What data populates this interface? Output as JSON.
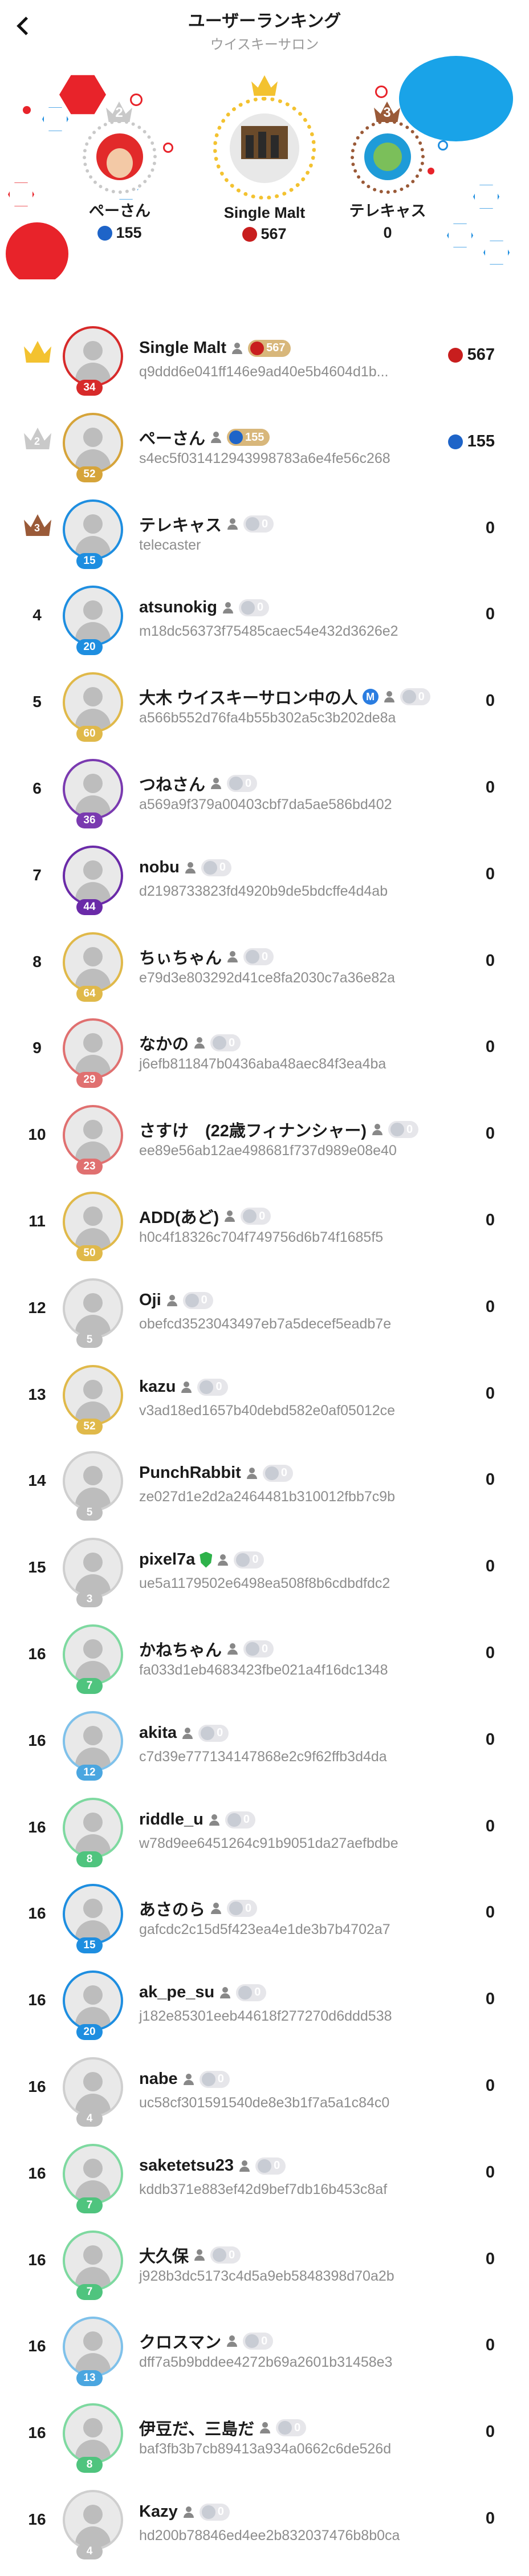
{
  "header": {
    "title": "ユーザーランキング",
    "subtitle": "ウイスキーサロン"
  },
  "colors": {
    "gold": "#f3c230",
    "silver": "#c9c9c9",
    "bronze": "#9a5a38",
    "accent_red": "#e8232a",
    "accent_blue": "#19a3e8"
  },
  "podium": {
    "first": {
      "rank": "1",
      "name": "Single Malt",
      "score": "567",
      "icon": "red-score-icon"
    },
    "second": {
      "rank": "2",
      "name": "ぺーさん",
      "score": "155",
      "icon": "blue-score-icon"
    },
    "third": {
      "rank": "3",
      "name": "テレキャス",
      "score": "0"
    }
  },
  "rows": [
    {
      "rank": "1",
      "level": "34",
      "name": "Single Malt",
      "pill": "567",
      "id": "q9ddd6e041ff146e9ad40e5b4604d1b...",
      "score": "567",
      "score_icon": "red",
      "ring": "#d72a2a",
      "lvl_color": "#d72a2a"
    },
    {
      "rank": "2",
      "level": "52",
      "name": "ぺーさん",
      "pill": "155",
      "id": "s4ec5f031412943998783a6e4fe56c268",
      "score": "155",
      "score_icon": "blue",
      "ring": "#d6a43a",
      "lvl_color": "#d6a43a"
    },
    {
      "rank": "3",
      "level": "15",
      "name": "テレキャス",
      "pill": "0",
      "id": "telecaster",
      "score": "0",
      "ring": "#1e8ee0",
      "lvl_color": "#1e8ee0"
    },
    {
      "rank": "4",
      "level": "20",
      "name": "atsunokig",
      "pill": "0",
      "id": "m18dc56373f75485caec54e432d3626e2",
      "score": "0",
      "ring": "#1e8ee0",
      "lvl_color": "#1e8ee0"
    },
    {
      "rank": "5",
      "level": "60",
      "name": "大木 ウイスキーサロン中の人",
      "pill": "0",
      "id": "a566b552d76fa4b55b302a5c3b202de8a",
      "score": "0",
      "ring": "#e0b94a",
      "lvl_color": "#e0b94a"
    },
    {
      "rank": "6",
      "level": "36",
      "name": "つねさん",
      "pill": "0",
      "id": "a569a9f379a00403cbf7da5ae586bd402",
      "score": "0",
      "ring": "#7a3ab0",
      "lvl_color": "#7a3ab0"
    },
    {
      "rank": "7",
      "level": "44",
      "name": "nobu",
      "pill": "0",
      "id": "d2198733823fd4920b9de5bdcffe4d4ab",
      "score": "0",
      "ring": "#6a2aa8",
      "lvl_color": "#6a2aa8"
    },
    {
      "rank": "8",
      "level": "64",
      "name": "ちぃちゃん",
      "pill": "0",
      "id": "e79d3e803292d41ce8fa2030c7a36e82a",
      "score": "0",
      "ring": "#e0b94a",
      "lvl_color": "#e0b94a"
    },
    {
      "rank": "9",
      "level": "29",
      "name": "なかの",
      "pill": "0",
      "id": "j6efb811847b0436aba48aec84f3ea4ba",
      "score": "0",
      "ring": "#e07070",
      "lvl_color": "#e07070"
    },
    {
      "rank": "10",
      "level": "23",
      "name": "さすけ　(22歳フィナンシャー)",
      "pill": "0",
      "id": "ee89e56ab12ae498681f737d989e08e40",
      "score": "0",
      "ring": "#e07070",
      "lvl_color": "#e07070"
    },
    {
      "rank": "11",
      "level": "50",
      "name": "ADD(あど)",
      "pill": "0",
      "id": "h0c4f18326c704f749756d6b74f1685f5",
      "score": "0",
      "ring": "#e0b94a",
      "lvl_color": "#e0b94a"
    },
    {
      "rank": "12",
      "level": "5",
      "name": "Oji",
      "pill": "0",
      "id": "obefcd3523043497eb7a5decef5eadb7e",
      "score": "0",
      "ring": "#cfcfcf",
      "lvl_color": "#bdbdbd"
    },
    {
      "rank": "13",
      "level": "52",
      "name": "kazu",
      "pill": "0",
      "id": "v3ad18ed1657b40debd582e0af05012ce",
      "score": "0",
      "ring": "#e0b94a",
      "lvl_color": "#e0b94a"
    },
    {
      "rank": "14",
      "level": "5",
      "name": "PunchRabbit",
      "pill": "0",
      "id": "ze027d1e2d2a2464481b310012fbb7c9b",
      "score": "0",
      "ring": "#cfcfcf",
      "lvl_color": "#bdbdbd"
    },
    {
      "rank": "15",
      "level": "3",
      "name": "pixel7a",
      "pill": "0",
      "id": "ue5a1179502e6498ea508f8b6cdbdfdc2",
      "score": "0",
      "ring": "#cfcfcf",
      "lvl_color": "#bdbdbd",
      "shield": true
    },
    {
      "rank": "16",
      "level": "7",
      "name": "かねちゃん",
      "pill": "0",
      "id": "fa033d1eb4683423fbe021a4f16dc1348",
      "score": "0",
      "ring": "#7ed9a0",
      "lvl_color": "#4fc47e"
    },
    {
      "rank": "16",
      "level": "12",
      "name": "akita",
      "pill": "0",
      "id": "c7d39e777134147868e2c9f62ffb3d4da",
      "score": "0",
      "ring": "#7fc1ea",
      "lvl_color": "#4aa6e0"
    },
    {
      "rank": "16",
      "level": "8",
      "name": "riddle_u",
      "pill": "0",
      "id": "w78d9ee6451264c91b9051da27aefbdbe",
      "score": "0",
      "ring": "#7ed9a0",
      "lvl_color": "#4fc47e"
    },
    {
      "rank": "16",
      "level": "15",
      "name": "あさのら",
      "pill": "0",
      "id": "gafcdc2c15d5f423ea4e1de3b7b4702a7",
      "score": "0",
      "ring": "#1e8ee0",
      "lvl_color": "#1e8ee0"
    },
    {
      "rank": "16",
      "level": "20",
      "name": "ak_pe_su",
      "pill": "0",
      "id": "j182e85301eeb44618f277270d6ddd538",
      "score": "0",
      "ring": "#1e8ee0",
      "lvl_color": "#1e8ee0"
    },
    {
      "rank": "16",
      "level": "4",
      "name": "nabe",
      "pill": "0",
      "id": "uc58cf301591540de8e3b1f7a5a1c84c0",
      "score": "0",
      "ring": "#cfcfcf",
      "lvl_color": "#bdbdbd"
    },
    {
      "rank": "16",
      "level": "7",
      "name": "saketetsu23",
      "pill": "0",
      "id": "kddb371e883ef42d9bef7db16b453c8af",
      "score": "0",
      "ring": "#7ed9a0",
      "lvl_color": "#4fc47e"
    },
    {
      "rank": "16",
      "level": "7",
      "name": "大久保",
      "pill": "0",
      "id": "j928b3dc5173c4d5a9eb5848398d70a2b",
      "score": "0",
      "ring": "#7ed9a0",
      "lvl_color": "#4fc47e"
    },
    {
      "rank": "16",
      "level": "13",
      "name": "クロスマン",
      "pill": "0",
      "id": "dff7a5b9bddee4272b69a2601b31458e3",
      "score": "0",
      "ring": "#7fc1ea",
      "lvl_color": "#4aa6e0"
    },
    {
      "rank": "16",
      "level": "8",
      "name": "伊豆だ、三島だ",
      "pill": "0",
      "id": "baf3fb3b7cb89413a934a0662c6de526d",
      "score": "0",
      "ring": "#7ed9a0",
      "lvl_color": "#4fc47e"
    },
    {
      "rank": "16",
      "level": "4",
      "name": "Kazy",
      "pill": "0",
      "id": "hd200b78846ed4ee2b832037476b8b0ca",
      "score": "0",
      "ring": "#cfcfcf",
      "lvl_color": "#bdbdbd"
    }
  ]
}
